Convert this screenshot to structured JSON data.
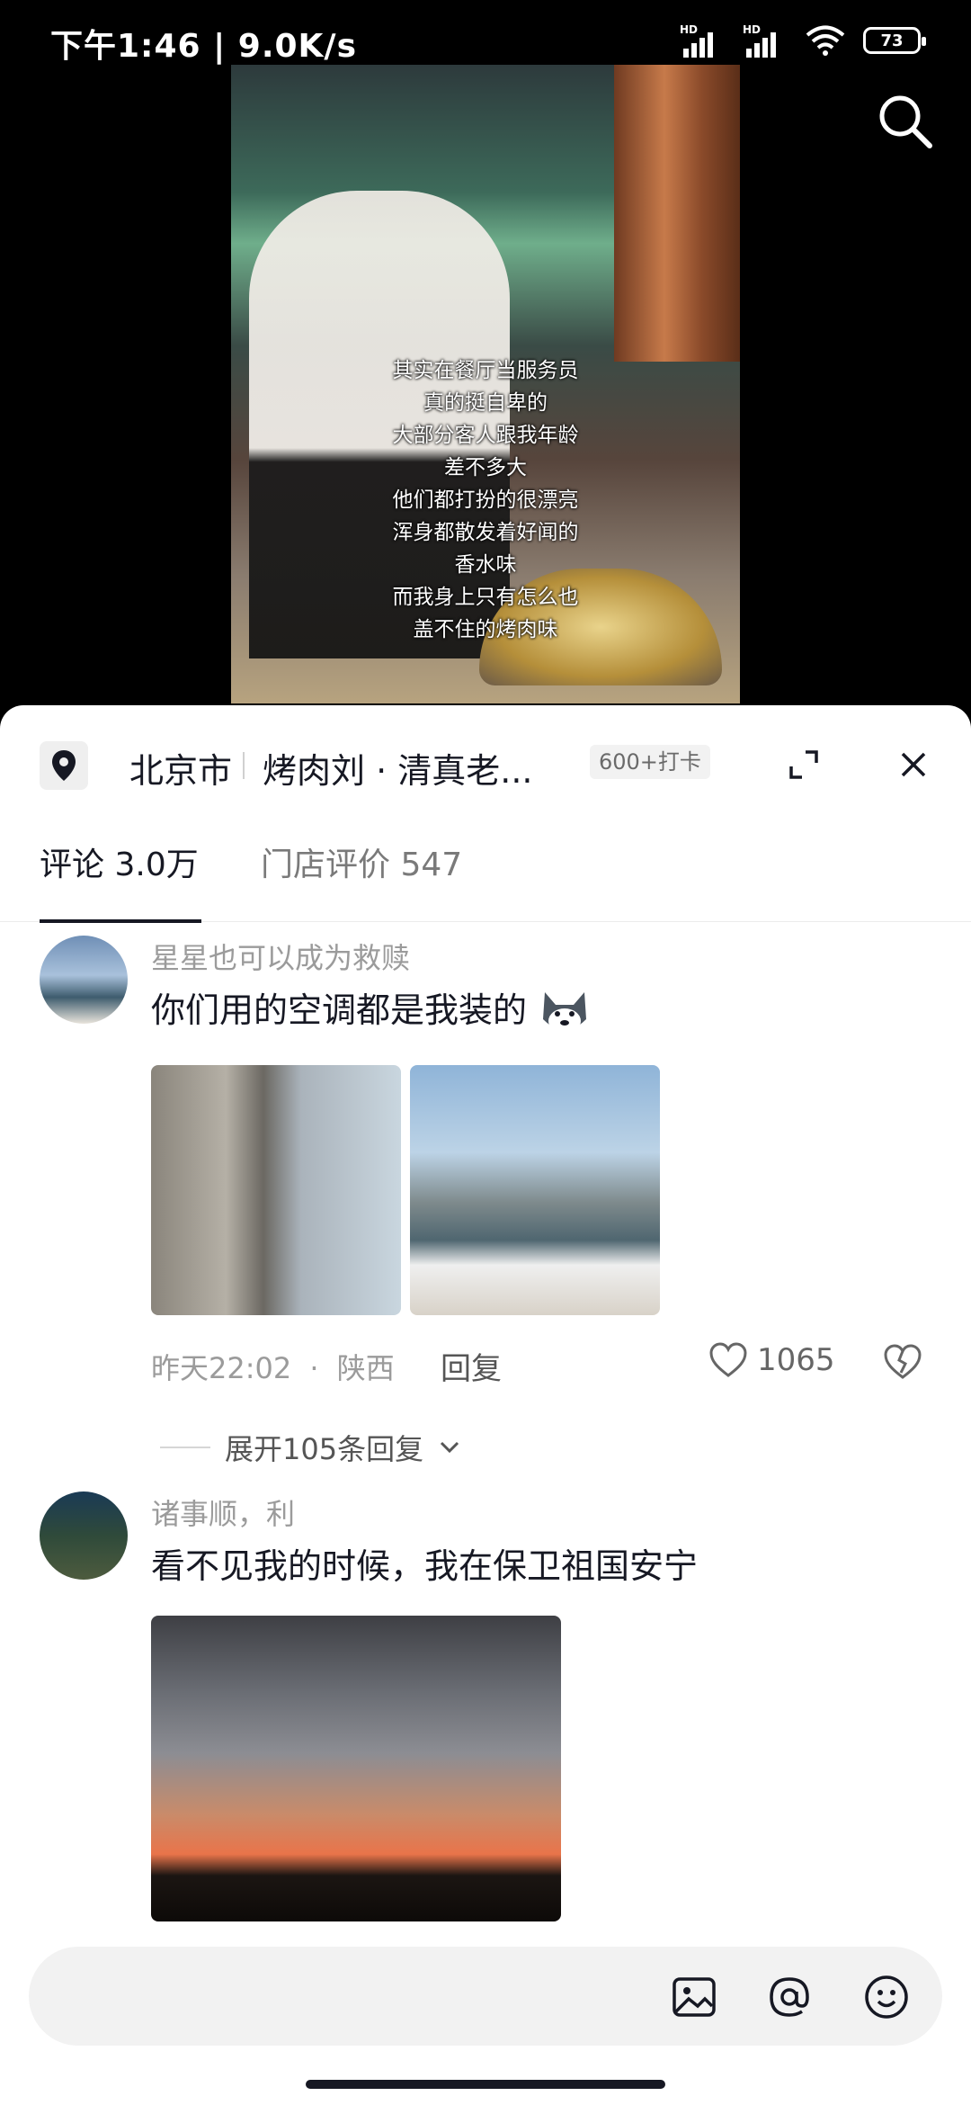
{
  "status_bar": {
    "time": "下午1:46",
    "speed": "9.0K/s",
    "sim1_label": "HD",
    "sim2_label": "HD",
    "battery": "73"
  },
  "video": {
    "caption_lines": [
      "其实在餐厅当服务员",
      "真的挺自卑的",
      "大部分客人跟我年龄",
      "差不多大",
      "他们都打扮的很漂亮",
      "浑身都散发着好闻的",
      "香水味",
      "而我身上只有怎么也",
      "盖不住的烤肉味"
    ]
  },
  "location_bar": {
    "city": "北京市",
    "place": "烤肉刘 · 清真老...",
    "badge": "600+打卡"
  },
  "tabs": [
    {
      "label": "评论",
      "count": "3.0万"
    },
    {
      "label": "门店评价",
      "count": "547"
    }
  ],
  "comments": [
    {
      "username": "星星也可以成为救赎",
      "text": "你们用的空调都是我装的",
      "time": "昨天22:02",
      "region": "陕西",
      "reply": "回复",
      "likes": "1065",
      "expand_replies": "展开105条回复"
    },
    {
      "username": "诸事顺，利",
      "text": "看不见我的时候，我在保卫祖国安宁"
    }
  ],
  "input": {
    "placeholder": ""
  },
  "icons": {
    "search": "search-icon",
    "location": "location-pin-icon",
    "expand": "expand-icon",
    "close": "close-icon",
    "like": "heart-icon",
    "dislike": "broken-heart-icon",
    "image": "image-icon",
    "mention": "at-icon",
    "emoji": "emoji-icon"
  },
  "colors": {
    "text_primary": "#161823",
    "text_secondary": "#9b9b9b",
    "sheet_bg": "#ffffff",
    "input_bg": "#f2f2f2"
  }
}
